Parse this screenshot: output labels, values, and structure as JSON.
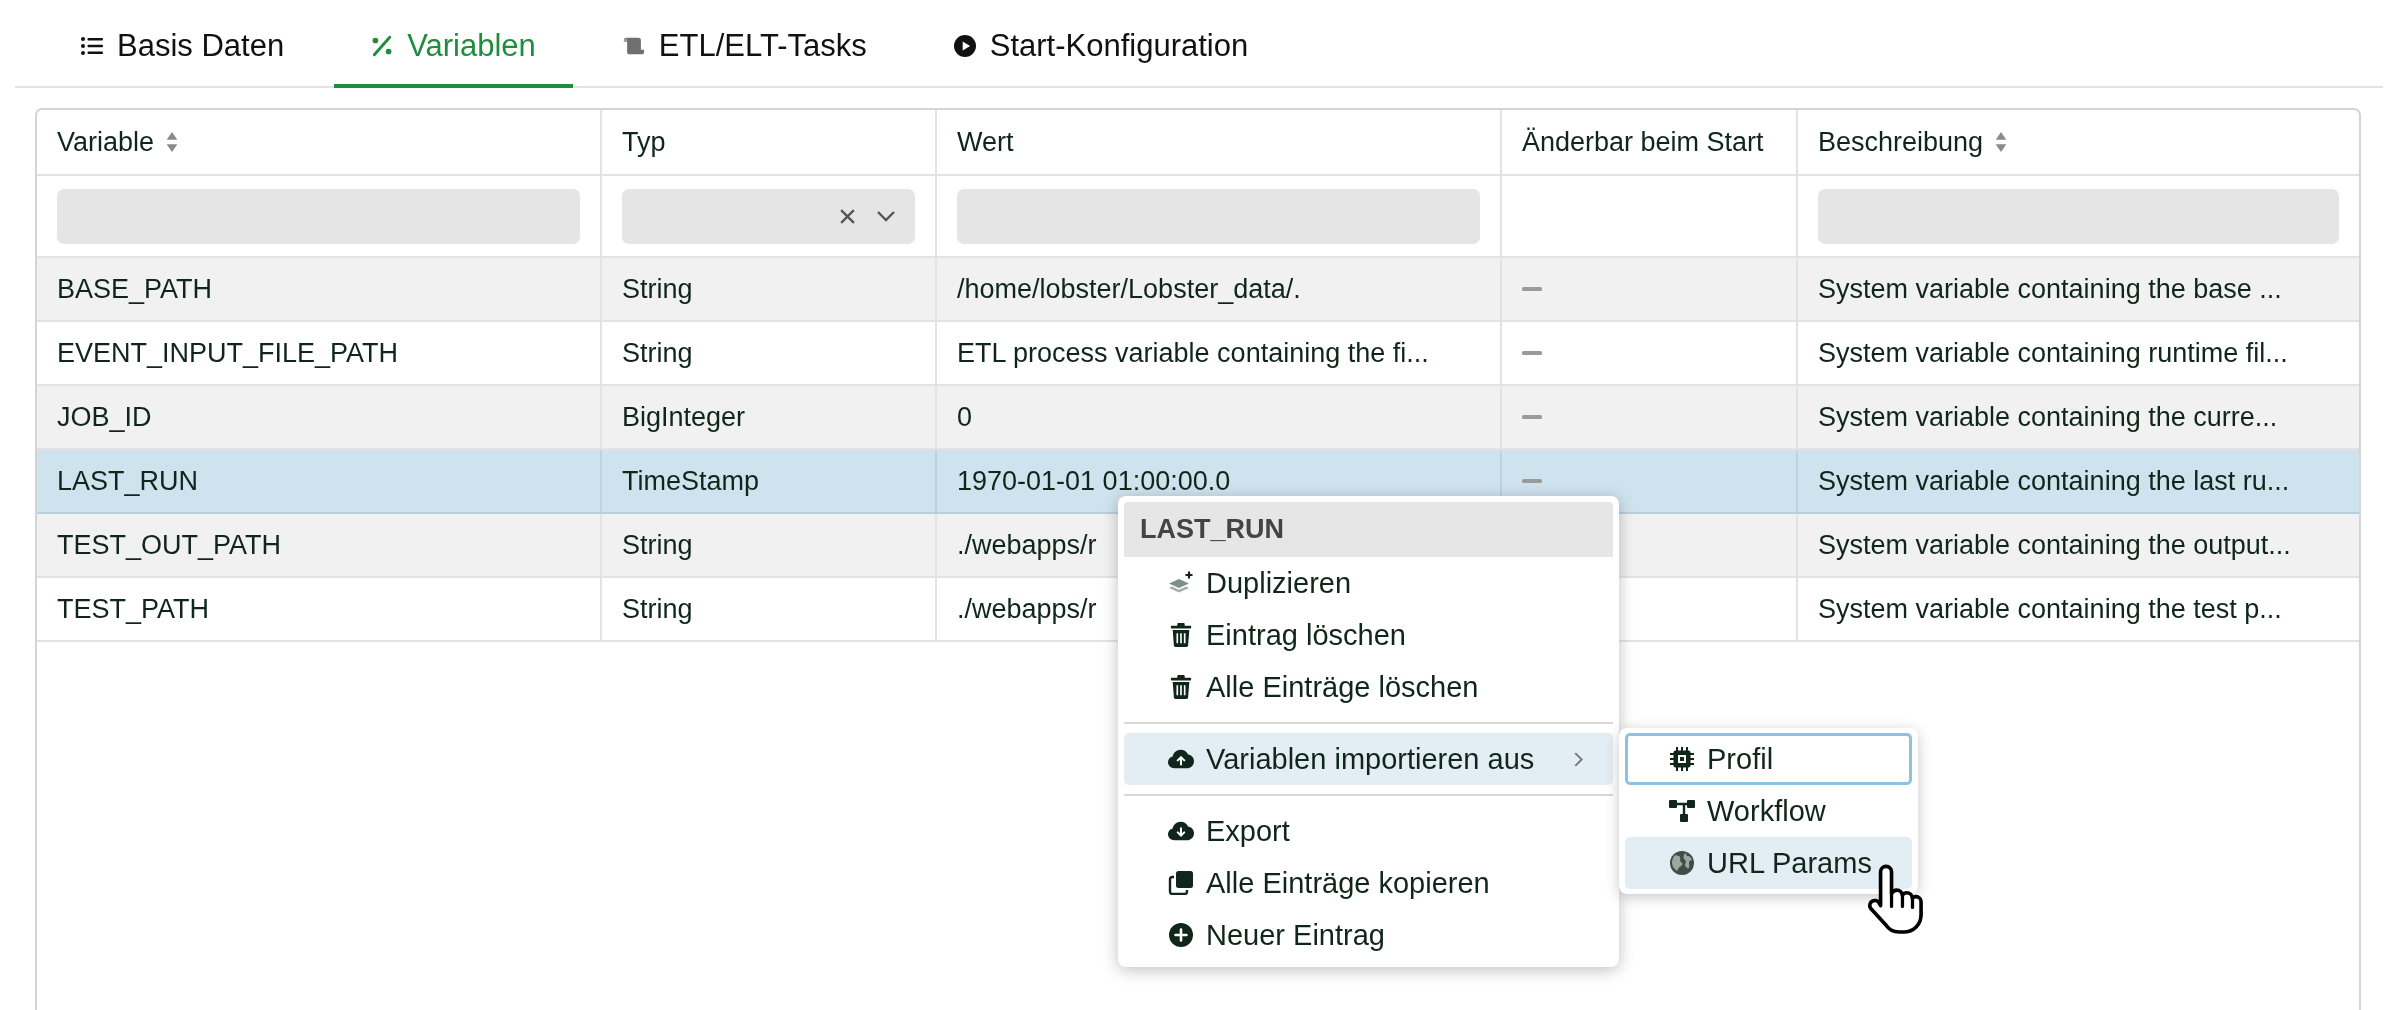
{
  "tabs": [
    {
      "label": "Basis Daten",
      "selected": false
    },
    {
      "label": "Variablen",
      "selected": true
    },
    {
      "label": "ETL/ELT-Tasks",
      "selected": false
    },
    {
      "label": "Start-Konfiguration",
      "selected": false
    }
  ],
  "table": {
    "columns": [
      {
        "label": "Variable",
        "sortable": true,
        "filter": {
          "kind": "text"
        }
      },
      {
        "label": "Typ",
        "sortable": false,
        "filter": {
          "kind": "select"
        }
      },
      {
        "label": "Wert",
        "sortable": false,
        "filter": {
          "kind": "text"
        }
      },
      {
        "label": "Änderbar beim Start",
        "sortable": false
      },
      {
        "label": "Beschreibung",
        "sortable": true,
        "filter": {
          "kind": "text"
        }
      }
    ],
    "rows": [
      {
        "variable": "BASE_PATH",
        "type": "String",
        "value": "/home/lobster/Lobster_data/.",
        "changeable": false,
        "description": "System variable containing the base ...",
        "selected": false
      },
      {
        "variable": "EVENT_INPUT_FILE_PATH",
        "type": "String",
        "value": "ETL process variable containing the fi...",
        "changeable": false,
        "description": "System variable containing runtime fil...",
        "selected": false
      },
      {
        "variable": "JOB_ID",
        "type": "BigInteger",
        "value": "0",
        "changeable": false,
        "description": "System variable containing the curre...",
        "selected": false
      },
      {
        "variable": "LAST_RUN",
        "type": "TimeStamp",
        "value": "1970-01-01 01:00:00.0",
        "changeable": false,
        "description": "System variable containing the last ru...",
        "selected": true
      },
      {
        "variable": "TEST_OUT_PATH",
        "type": "String",
        "value": "./webapps/r",
        "description": "System variable containing the output...",
        "selected": false
      },
      {
        "variable": "TEST_PATH",
        "type": "String",
        "value": "./webapps/r",
        "description": "System variable containing the test p...",
        "selected": false
      }
    ]
  },
  "context_menu": {
    "title": "LAST_RUN",
    "sections": [
      {
        "items": [
          {
            "label": "Duplizieren",
            "highlighted": false
          },
          {
            "label": "Eintrag löschen",
            "highlighted": false
          },
          {
            "label": "Alle Einträge löschen",
            "highlighted": false
          }
        ]
      },
      {
        "items": [
          {
            "label": "Variablen importieren aus",
            "highlighted": true,
            "submenu": {
              "items": [
                {
                  "label": "Profil",
                  "highlighted": false,
                  "focused": true
                },
                {
                  "label": "Workflow",
                  "highlighted": false,
                  "focused": false
                },
                {
                  "label": "URL Params",
                  "highlighted": true,
                  "focused": false
                }
              ]
            }
          }
        ]
      },
      {
        "items": [
          {
            "label": "Export",
            "highlighted": false
          },
          {
            "label": "Alle Einträge kopieren",
            "highlighted": false
          },
          {
            "label": "Neuer Eintrag",
            "highlighted": false
          }
        ]
      }
    ]
  }
}
